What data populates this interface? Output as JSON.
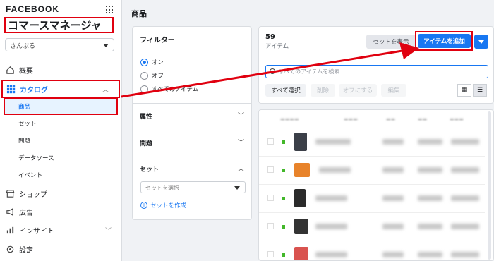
{
  "brand": "FACEBOOK",
  "app_title": "コマースマネージャ",
  "account": "さんぷる",
  "nav": {
    "overview": "概要",
    "catalog": "カタログ",
    "catalog_sub": [
      "商品",
      "セット",
      "問題",
      "データソース",
      "イベント"
    ],
    "shop": "ショップ",
    "ads": "広告",
    "insights": "インサイト",
    "settings": "設定"
  },
  "page_title": "商品",
  "filter": {
    "title": "フィルター",
    "options": [
      "オン",
      "オフ",
      "すべてのアイテム"
    ],
    "selected": "オン",
    "sections": [
      "属性",
      "問題",
      "セット"
    ],
    "set_placeholder": "セットを選択",
    "create_set": "セットを作成"
  },
  "items": {
    "count": "59",
    "count_label": "アイテム",
    "set_button": "セットを表示",
    "add_button": "アイテムを追加",
    "search_placeholder": "すべてのアイテムを検索",
    "actions": [
      "すべて選択",
      "削除",
      "オフにする",
      "編集"
    ]
  },
  "colors": {
    "accent": "#1877f2",
    "highlight": "#e0000f"
  }
}
